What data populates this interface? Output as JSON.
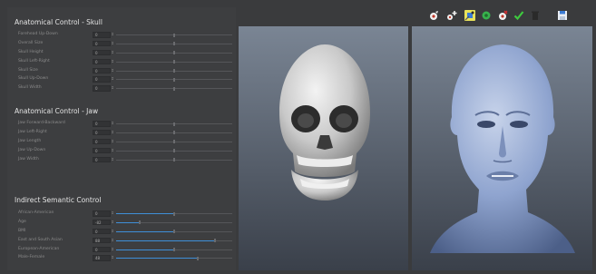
{
  "skull": {
    "title": "Anatomical Control - Skull",
    "rows": [
      {
        "label": "Forehead Up-Down",
        "value": "0",
        "fill": 0
      },
      {
        "label": "Overall Size",
        "value": "0",
        "fill": 0
      },
      {
        "label": "Skull Height",
        "value": "0",
        "fill": 0
      },
      {
        "label": "Skull Left-Right",
        "value": "0",
        "fill": 0
      },
      {
        "label": "Skull Size",
        "value": "0",
        "fill": 0
      },
      {
        "label": "Skull Up-Down",
        "value": "0",
        "fill": 0
      },
      {
        "label": "Skull Width",
        "value": "0",
        "fill": 0
      }
    ]
  },
  "jaw": {
    "title": "Anatomical Control - Jaw",
    "rows": [
      {
        "label": "Jaw Forward-Backward",
        "value": "0",
        "fill": 0
      },
      {
        "label": "Jaw Left-Right",
        "value": "0",
        "fill": 0
      },
      {
        "label": "Jaw Length",
        "value": "0",
        "fill": 0
      },
      {
        "label": "Jaw Up-Down",
        "value": "0",
        "fill": 0
      },
      {
        "label": "Jaw Width",
        "value": "0",
        "fill": 0
      }
    ]
  },
  "semantic": {
    "title": "Indirect Semantic Control",
    "rows": [
      {
        "label": "African-American",
        "value": "0",
        "fill": 0.5
      },
      {
        "label": "Age",
        "value": "-82",
        "fill": 0.2
      },
      {
        "label": "BMI",
        "value": "0",
        "fill": 0.5
      },
      {
        "label": "East and South Asian",
        "value": "88",
        "fill": 0.85
      },
      {
        "label": "European-American",
        "value": "0",
        "fill": 0.5
      },
      {
        "label": "Male-Female",
        "value": "48",
        "fill": 0.7
      }
    ]
  },
  "toolbar": {
    "icons": [
      "select-icon",
      "add-landmark-icon",
      "move-icon",
      "settings-icon",
      "remove-landmark-icon",
      "confirm-icon",
      "trash-icon",
      "save-icon"
    ]
  },
  "colors": {
    "panel": "#3d3e40",
    "slider_fill": "#3f8fd8",
    "viewport_top": "#7a8594",
    "viewport_bottom": "#3a404a",
    "skull_color": "#d6d6d6",
    "face_color": "#8fa4cf"
  }
}
